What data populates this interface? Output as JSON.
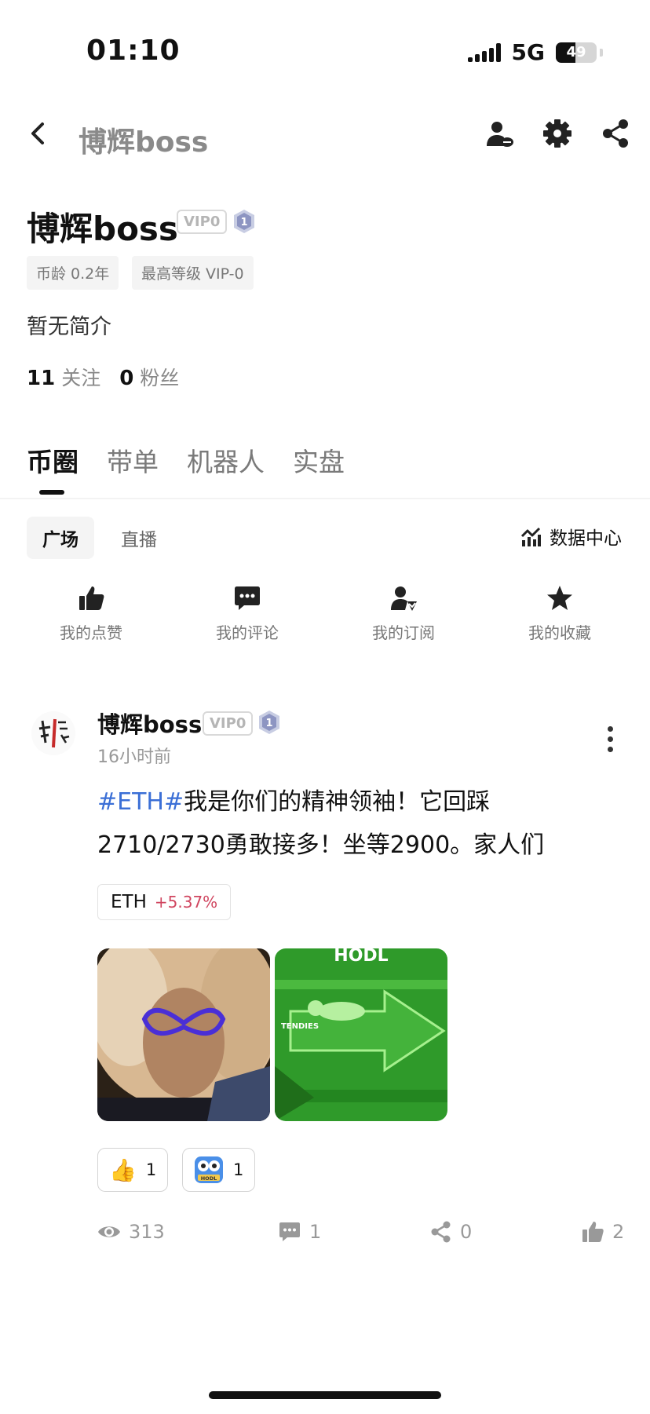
{
  "status_bar": {
    "time": "01:10",
    "network": "5G",
    "battery": "49",
    "battery_level": 0.49
  },
  "nav": {
    "title": "博辉boss"
  },
  "profile": {
    "name": "博辉boss",
    "vip_tag": "VIP0",
    "level_badge": "1",
    "chips": [
      "币龄 0.2年",
      "最高等级 VIP-0"
    ],
    "bio": "暂无简介",
    "following_count": "11",
    "following_label": "关注",
    "followers_count": "0",
    "followers_label": "粉丝"
  },
  "tabs": [
    "币圈",
    "带单",
    "机器人",
    "实盘"
  ],
  "sub_tabs": {
    "active": "广场",
    "other": "直播",
    "data_center": "数据中心"
  },
  "quick_actions": [
    {
      "label": "我的点赞",
      "icon": "thumbs-up-icon"
    },
    {
      "label": "我的评论",
      "icon": "comment-icon"
    },
    {
      "label": "我的订阅",
      "icon": "subscribe-icon"
    },
    {
      "label": "我的收藏",
      "icon": "star-icon"
    }
  ],
  "post": {
    "author": "博辉boss",
    "vip_tag": "VIP0",
    "level_badge": "1",
    "time": "16小时前",
    "hashtag": "#ETH#",
    "text": "我是你们的精神领袖！它回踩2710/2730勇敢接多！坐等2900。家人们",
    "coin": {
      "symbol": "ETH",
      "change": "+5.37%"
    },
    "images": [
      {
        "caption": ""
      },
      {
        "caption": "HODL",
        "sub_caption": "TENDIES"
      }
    ],
    "reactions": [
      {
        "emoji": "👍",
        "count": "1"
      },
      {
        "sticker_text": "HODL",
        "count": "1"
      }
    ],
    "stats": {
      "views": "313",
      "comments": "1",
      "shares": "0",
      "likes": "2"
    }
  },
  "colors": {
    "hashtag": "#3b6fd6",
    "price_up": "#d0455f",
    "text_primary": "#111111",
    "text_secondary": "#888888"
  }
}
